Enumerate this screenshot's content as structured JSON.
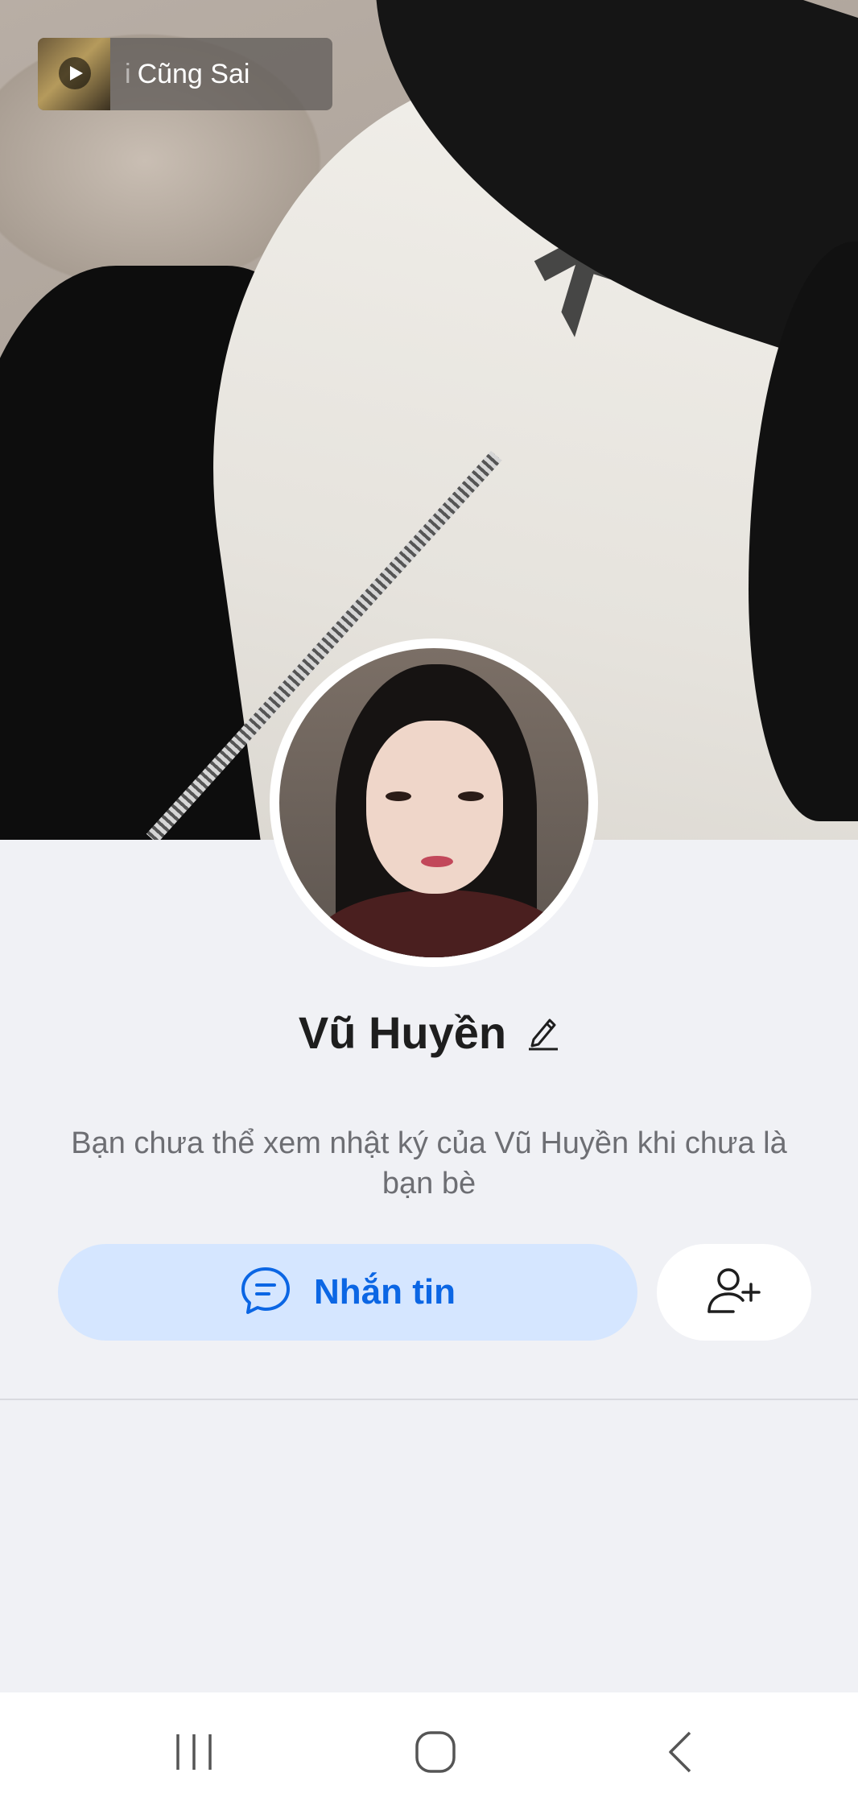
{
  "music": {
    "title": "Cũng Sai",
    "prefix": "i"
  },
  "profile": {
    "name": "Vũ Huyền"
  },
  "privacy_note": "Bạn chưa thể xem nhật ký của Vũ Huyền khi chưa là bạn bè",
  "actions": {
    "message_label": "Nhắn tin"
  },
  "colors": {
    "accent": "#0b66e4",
    "message_button_bg": "#d5e6ff",
    "page_bg": "#f0f1f5"
  },
  "icons": {
    "play": "play-icon",
    "edit": "pencil-icon",
    "chat": "chat-bubble-icon",
    "add_friend": "add-user-icon",
    "recent": "recent-apps-icon",
    "home": "home-icon",
    "back": "back-icon"
  }
}
